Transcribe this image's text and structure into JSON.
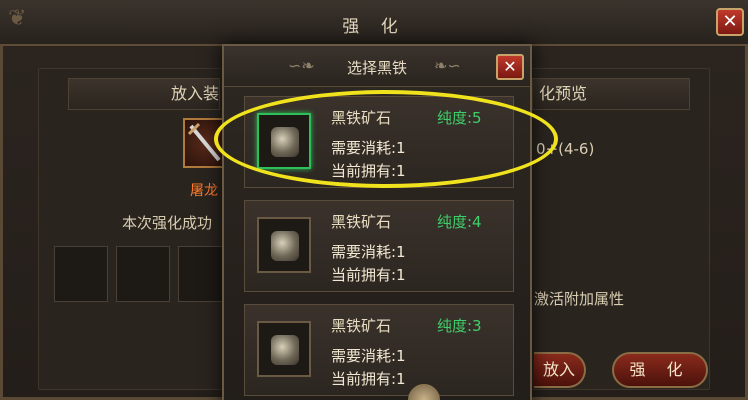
{
  "window": {
    "title": "强 化",
    "close_glyph": "✕"
  },
  "left_section": {
    "header": "放入装",
    "equip_name": "屠龙",
    "success_label": "本次强化成功"
  },
  "right_section": {
    "header": "化预览",
    "preview_value": "0+(4-6)",
    "activate_text": "激活附加属性"
  },
  "buttons": {
    "put_in": "放入",
    "strengthen": "强 化"
  },
  "popup": {
    "title": "选择黑铁",
    "close_glyph": "✕",
    "items": [
      {
        "name": "黑铁矿石",
        "purity": "纯度:5",
        "need": "需要消耗:1",
        "own": "当前拥有:1",
        "selected": true
      },
      {
        "name": "黑铁矿石",
        "purity": "纯度:4",
        "need": "需要消耗:1",
        "own": "当前拥有:1",
        "selected": false
      },
      {
        "name": "黑铁矿石",
        "purity": "纯度:3",
        "need": "需要消耗:1",
        "own": "当前拥有:1",
        "selected": false
      }
    ]
  },
  "colors": {
    "purity": "#3fce6a",
    "highlight": "#f1e21e",
    "equip_name": "#ff7a2a"
  }
}
